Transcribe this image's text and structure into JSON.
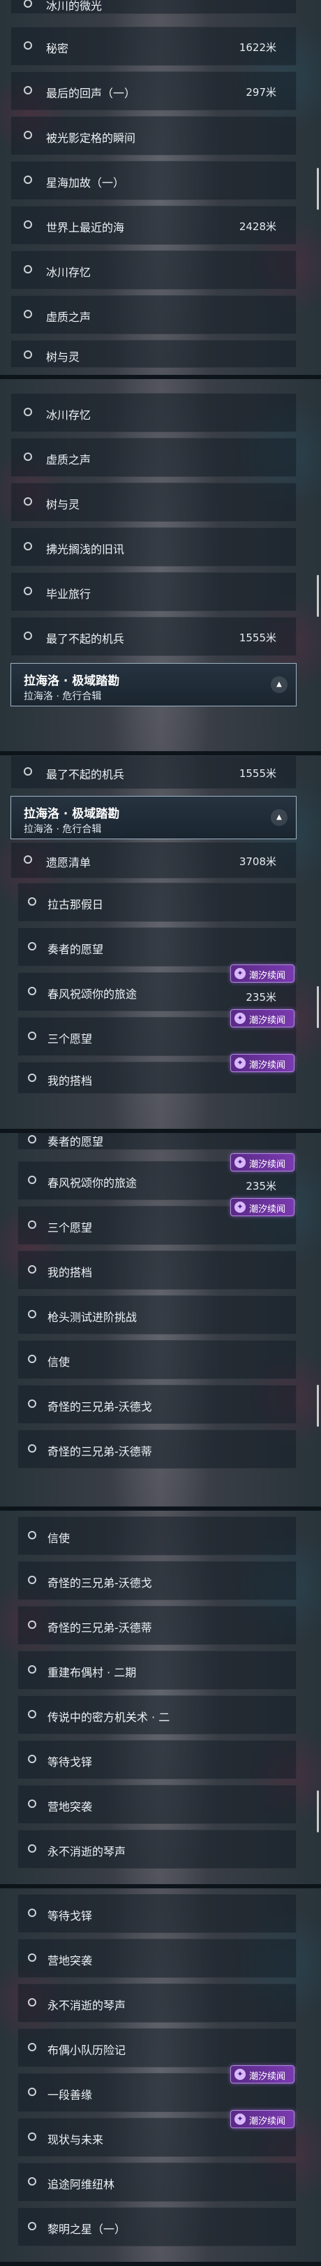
{
  "badge_text": "潮汐续闻",
  "group": {
    "title": "拉海洛 · 极域踏勘",
    "subtitle": "拉海洛 · 危行合辑"
  },
  "rows": {
    "top_cut": "冰川的微光",
    "mimi": "秘密",
    "mimi_dist": "1622米",
    "zuihou": "最后的回声（一）",
    "zuihou_dist": "297米",
    "beiguang": "被光影定格的瞬间",
    "xinghai": "星海加故（一）",
    "shijie": "世界上最近的海",
    "shijie_dist": "2428米",
    "bingchuan": "冰川存忆",
    "xuzhi": "虚质之声",
    "shuyuling": "树与灵",
    "fuguang": "拂光搁浅的旧讯",
    "biye": "毕业旅行",
    "liaobuqi": "最了不起的机兵",
    "liaobuqi_dist": "1555米",
    "yiyi": "遗愿清单",
    "yiyi_dist": "3708米",
    "lagu": "拉古那假日",
    "qinzhe": "奏者的愿望",
    "chunfeng": "春风祝颂你的旅途",
    "chunfeng_dist": "235米",
    "sange": "三个愿望",
    "qinzhe_cut": "奏者的愿望",
    "wode": "我的搭档",
    "qiangtou": "枪头测试进阶挑战",
    "xinshi": "信使",
    "qiguai_wo": "奇怪的三兄弟-沃德戈",
    "qiguai_de": "奇怪的三兄弟-沃德蒂",
    "chongjian": "重建布偶村 · 二期",
    "chuanshuo": "传说中的密方机关术 · 二",
    "dengdai": "等待戈铎",
    "yingdi": "营地突袭",
    "yongbu": "永不消逝的琴声",
    "buou": "布偶小队历险记",
    "yiduan": "一段善缘",
    "xianzhuang": "现状与未来",
    "zhuiyi": "追途阿维纽林",
    "liming": "黎明之星（一）"
  }
}
